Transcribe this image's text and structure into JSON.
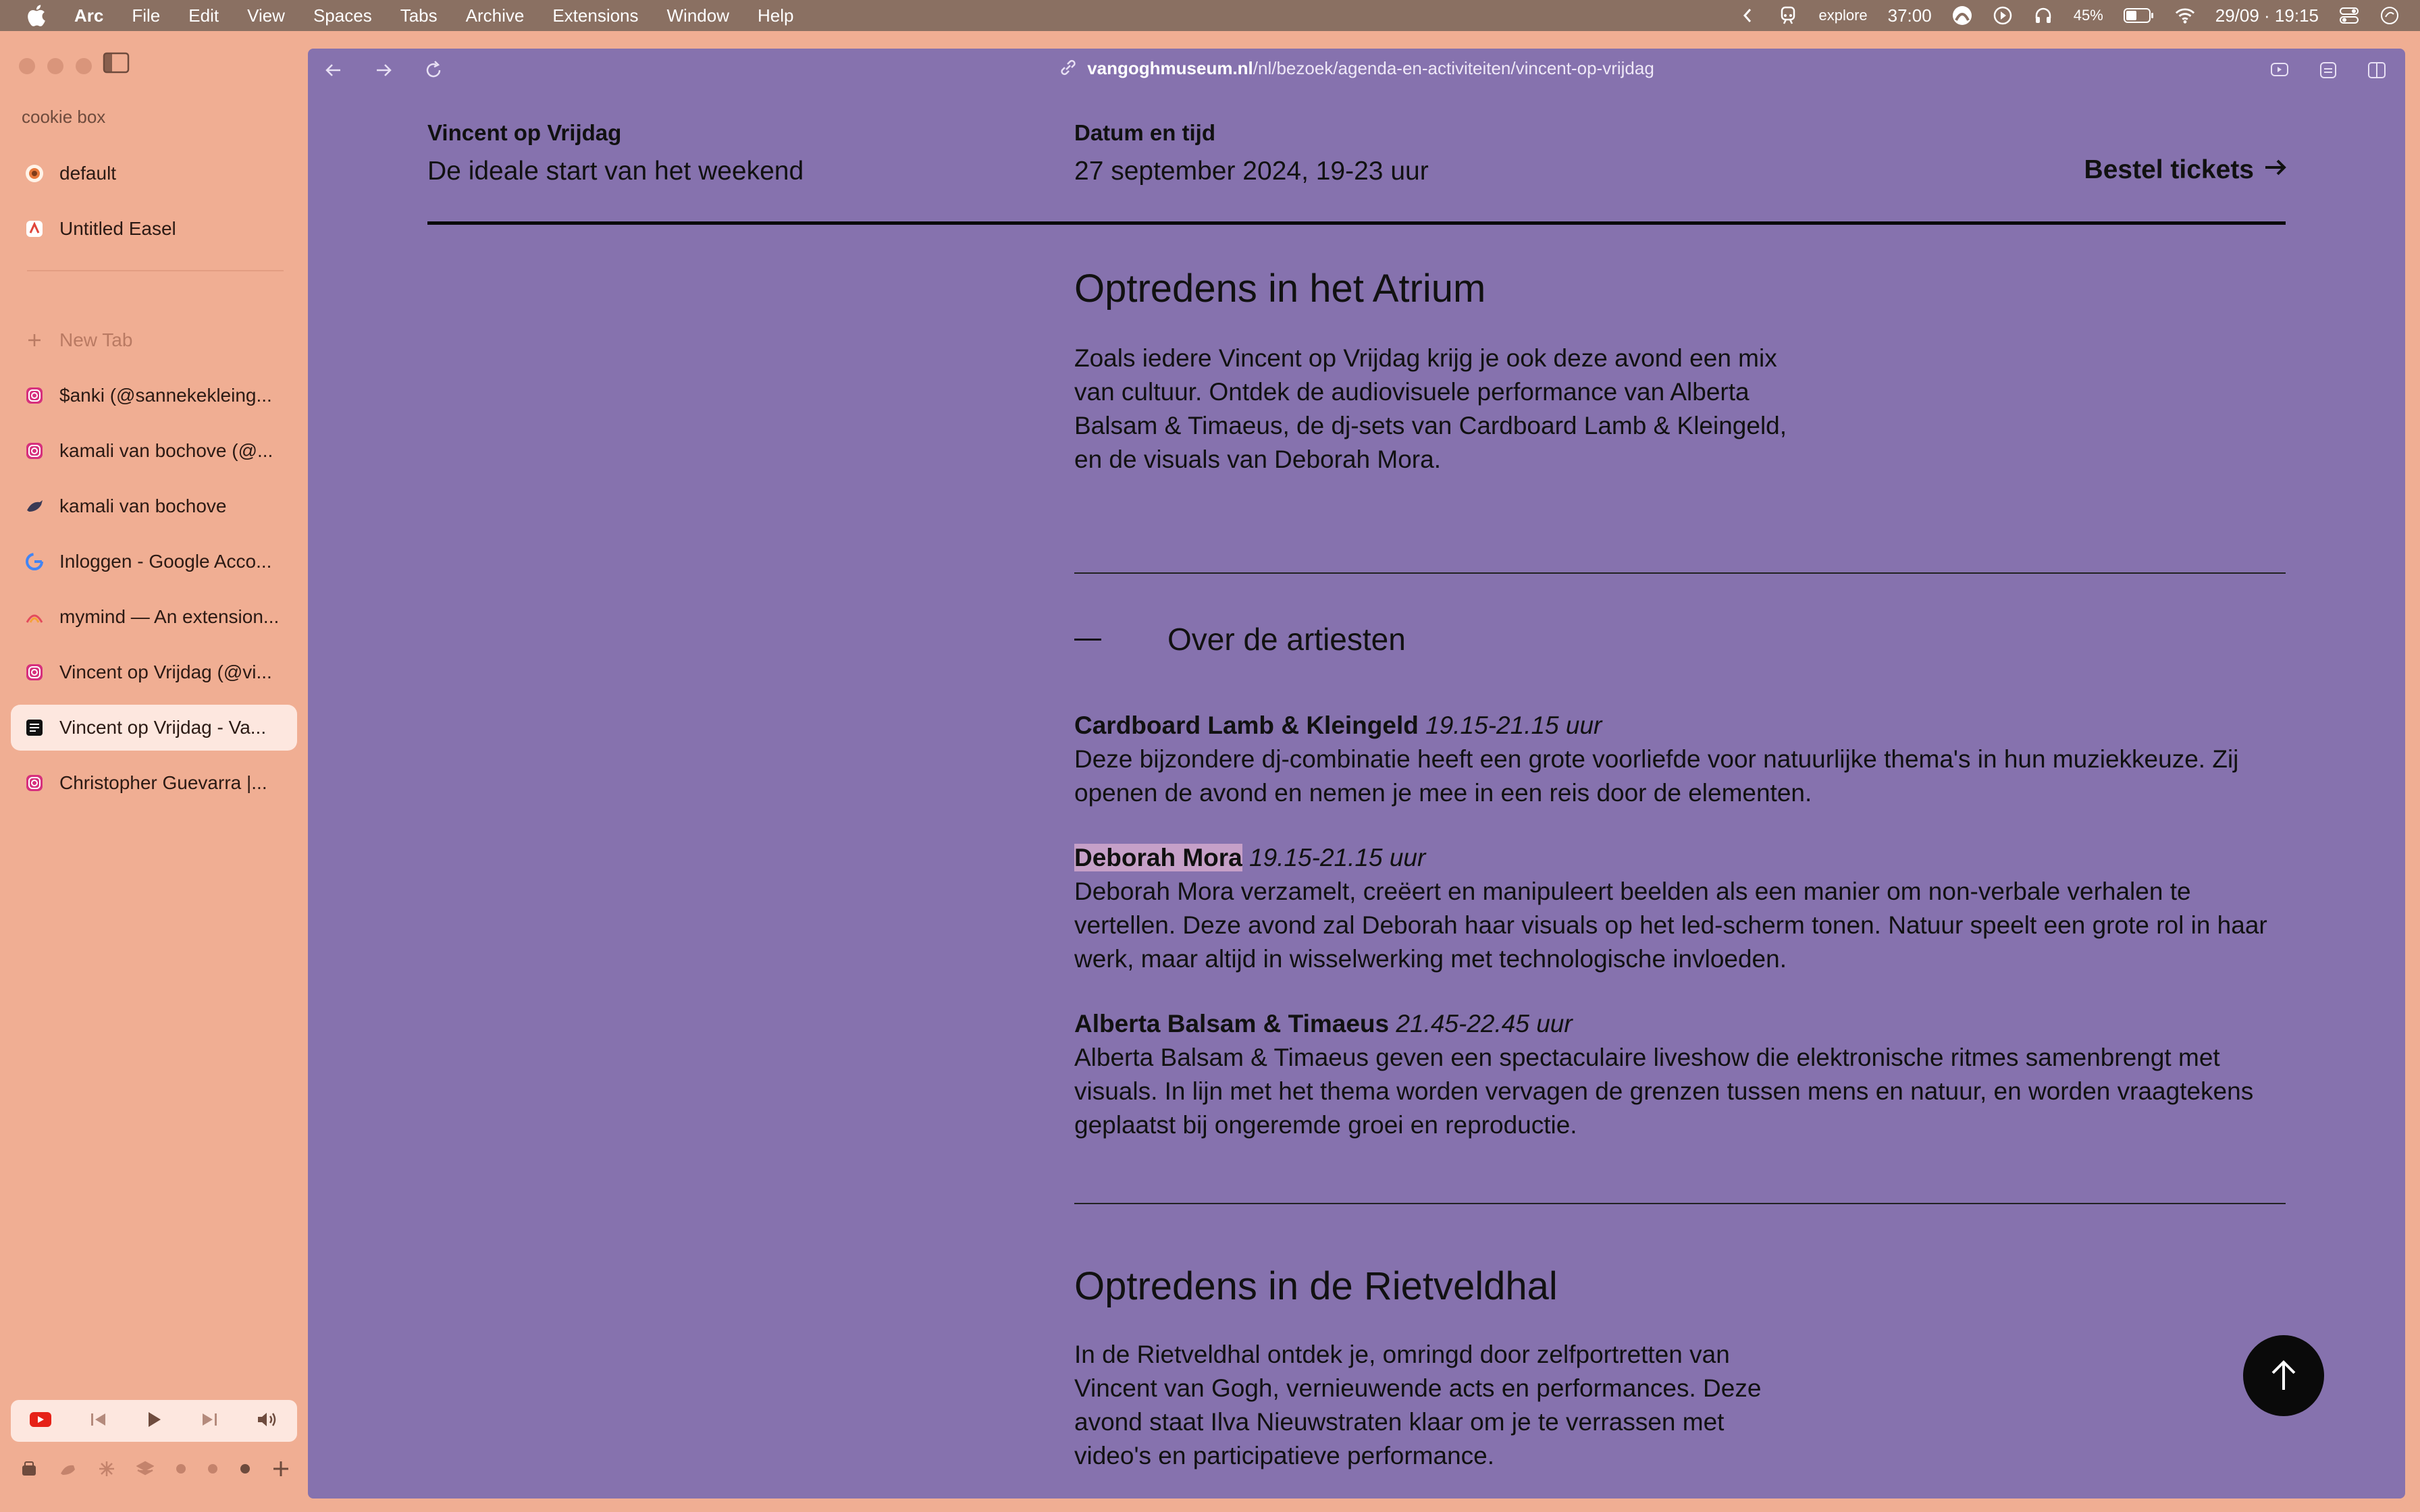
{
  "menubar": {
    "app": "Arc",
    "items": [
      "File",
      "Edit",
      "View",
      "Spaces",
      "Tabs",
      "Archive",
      "Extensions",
      "Window",
      "Help"
    ],
    "status_text": "explore",
    "timer": "37:00",
    "battery": "45%",
    "datetime": "29/09 · 19:15"
  },
  "sidebar": {
    "space_name": "cookie box",
    "pinned": [
      {
        "label": "default",
        "icon": "arc-favicon"
      },
      {
        "label": "Untitled Easel",
        "icon": "easel-favicon"
      }
    ],
    "new_tab": "New Tab",
    "tabs": [
      {
        "label": "$anki (@sannekekleing...",
        "icon": "instagram-favicon"
      },
      {
        "label": "kamali van bochove (@...",
        "icon": "instagram-favicon"
      },
      {
        "label": "kamali van bochove",
        "icon": "bird-favicon"
      },
      {
        "label": "Inloggen - Google Acco...",
        "icon": "google-favicon"
      },
      {
        "label": "mymind — An extension...",
        "icon": "mymind-favicon"
      },
      {
        "label": "Vincent op Vrijdag (@vi...",
        "icon": "instagram-favicon"
      },
      {
        "label": "Vincent op Vrijdag - Va...",
        "icon": "vangogh-favicon"
      },
      {
        "label": "Christopher Guevarra |...",
        "icon": "instagram-favicon"
      }
    ]
  },
  "browser": {
    "url_domain": "vangoghmuseum.nl",
    "url_path": "/nl/bezoek/agenda-en-activiteiten/vincent-op-vrijdag"
  },
  "page": {
    "header": {
      "title": "Vincent op Vrijdag",
      "subtitle": "De ideale start van het weekend",
      "date_label": "Datum en tijd",
      "date_value": "27 september 2024, 19-23 uur",
      "tickets_label": "Bestel tickets"
    },
    "atrium": {
      "heading": "Optredens in het Atrium",
      "text": "Zoals iedere Vincent op Vrijdag krijg je ook deze avond een mix van cultuur. Ontdek de audiovisuele performance van Alberta Balsam & Timaeus, de dj-sets van Cardboard Lamb & Kleingeld, en de visuals van Deborah Mora."
    },
    "artists_toggle": "Over de artiesten",
    "artists": [
      {
        "name": "Cardboard Lamb & Kleingeld",
        "time": "19.15-21.15 uur",
        "text": "Deze bijzondere dj-combinatie heeft een grote voorliefde voor natuurlijke thema's in hun muziekkeuze. Zij openen de avond en nemen je mee in een reis door de elementen."
      },
      {
        "name": "Deborah Mora",
        "time": "19.15-21.15 uur",
        "text": "Deborah Mora verzamelt, creëert en manipuleert beelden als een manier om non-verbale verhalen te vertellen. Deze avond zal Deborah haar visuals op het led-scherm tonen. Natuur speelt een grote rol in haar werk, maar altijd in wisselwerking met technologische invloeden."
      },
      {
        "name": "Alberta Balsam & Timaeus",
        "time": "21.45-22.45 uur",
        "text": "Alberta Balsam & Timaeus geven een spectaculaire liveshow die elektronische ritmes samenbrengt met visuals. In lijn met het thema worden vervagen de grenzen tussen mens en natuur, en worden vraagtekens geplaatst bij ongeremde groei en reproductie."
      }
    ],
    "rietveld": {
      "heading": "Optredens in de Rietveldhal",
      "text": "In de Rietveldhal ontdek je, omringd door zelfportretten van Vincent van Gogh, vernieuwende acts en performances. Deze avond staat Ilva Nieuwstraten klaar om je te verrassen met video's en participatieve performance."
    }
  },
  "colors": {
    "page_bg": "#8672ae",
    "sidebar_bg": "#f0ae93",
    "highlight": "#c6a0c8"
  }
}
